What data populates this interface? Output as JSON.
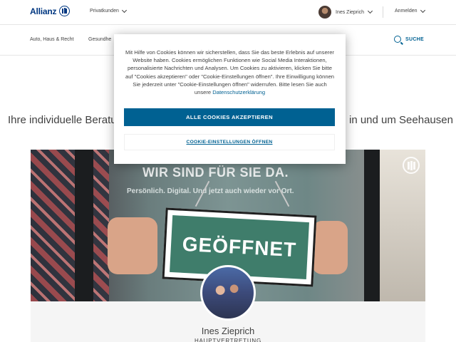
{
  "header": {
    "logo_text": "Allianz",
    "segment_label": "Privatkunden",
    "agent_name": "Ines Zieprich",
    "login_label": "Anmelden"
  },
  "mainnav": {
    "items": [
      "Auto, Haus & Recht",
      "Gesundhe"
    ],
    "search_label": "SUCHE"
  },
  "intro": {
    "left": "Ihre individuelle Beratu",
    "right": "in und um Seehausen"
  },
  "hero": {
    "headline": "WIR SIND FÜR SIE DA.",
    "subline": "Persönlich. Digital. Und jetzt auch wieder vor Ort.",
    "sign_text": "GEÖFFNET"
  },
  "profile": {
    "name": "Ines Zieprich",
    "role": "HAUPTVERTRETUNG"
  },
  "cookie_modal": {
    "text": "Mit Hilfe von Cookies können wir sicherstellen, dass Sie das beste Erlebnis auf unserer Website haben. Cookies ermöglichen Funktionen wie Social Media Interaktionen, personalisierte Nachrichten und Analysen. Um Cookies zu aktivieren, klicken Sie bitte auf \"Cookies akzeptieren\" oder \"Cookie-Einstellungen öffnen\". Ihre Einwilligung können Sie jederzeit unter \"Cookie-Einstellungen öffnen\" widerrufen. Bitte lesen Sie auch unsere",
    "link_label": "Datenschutzerklärung",
    "accept_label": "ALLE COOKIES AKZEPTIEREN",
    "settings_label": "COOKIE-EINSTELLUNGEN ÖFFNEN"
  },
  "colors": {
    "brand": "#003781",
    "accent": "#006192",
    "text": "#414141"
  }
}
